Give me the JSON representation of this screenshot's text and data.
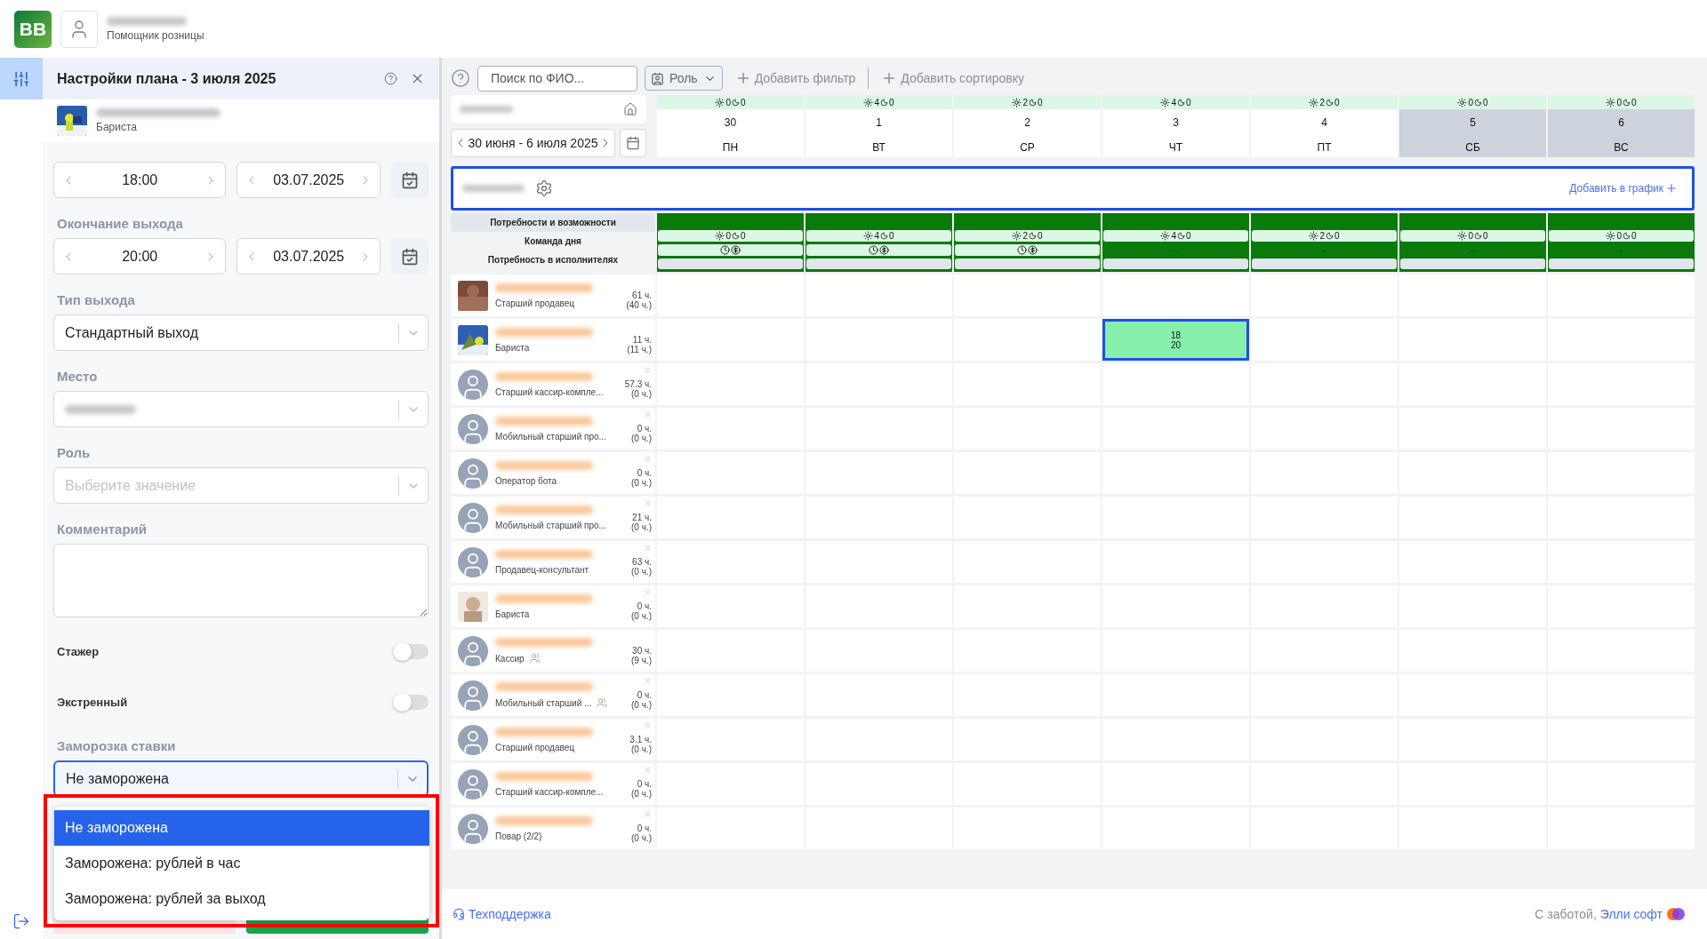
{
  "app": {
    "logo": "BB",
    "user_role": "Помощник розницы"
  },
  "panel": {
    "title": "Настройки плана - 3 июля 2025",
    "employee_role": "Бариста",
    "start": {
      "time": "18:00",
      "date": "03.07.2025"
    },
    "end": {
      "label": "Окончание выхода",
      "time": "20:00",
      "date": "03.07.2025"
    },
    "shift_type": {
      "label": "Тип выхода",
      "value": "Стандартный выход"
    },
    "place": {
      "label": "Место"
    },
    "role": {
      "label": "Роль",
      "placeholder": "Выберите значение"
    },
    "comment": {
      "label": "Комментарий"
    },
    "toggles": [
      {
        "label": "Стажер",
        "on": false
      },
      {
        "label": "Экстренный",
        "on": false
      }
    ],
    "freeze": {
      "label": "Заморозка ставки",
      "value": "Не заморожена",
      "open": true,
      "options": [
        {
          "label": "Не заморожена",
          "selected": true
        },
        {
          "label": "Заморожена: рублей в час",
          "selected": false
        },
        {
          "label": "Заморожена: рублей за выход",
          "selected": false
        }
      ]
    }
  },
  "toolbar": {
    "search_placeholder": "Поиск по ФИО...",
    "role_filter": "Роль",
    "add_filter": "Добавить фильтр",
    "add_sort": "Добавить сортировку"
  },
  "week": "30 июня - 6 июля 2025",
  "days": [
    {
      "num": "30",
      "weekday": "ПН",
      "sun": "0",
      "moon": "0",
      "weekend": false,
      "need_sun": "0",
      "need_moon": "0",
      "team": {
        "kind": "icons"
      }
    },
    {
      "num": "1",
      "weekday": "ВТ",
      "sun": "4",
      "moon": "0",
      "weekend": false,
      "need_sun": "4",
      "need_moon": "0",
      "team": {
        "kind": "icons"
      }
    },
    {
      "num": "2",
      "weekday": "СР",
      "sun": "2",
      "moon": "0",
      "weekend": false,
      "need_sun": "2",
      "need_moon": "0",
      "team": {
        "kind": "icons"
      }
    },
    {
      "num": "3",
      "weekday": "ЧТ",
      "sun": "4",
      "moon": "0",
      "weekend": false,
      "need_sun": "4",
      "need_moon": "0",
      "team": {
        "kind": "dash",
        "text": "-"
      }
    },
    {
      "num": "4",
      "weekday": "ПТ",
      "sun": "2",
      "moon": "0",
      "weekend": false,
      "need_sun": "2",
      "need_moon": "0",
      "team": {
        "kind": "dash",
        "text": "-"
      }
    },
    {
      "num": "5",
      "weekday": "СБ",
      "sun": "0",
      "moon": "0",
      "weekend": true,
      "need_sun": "0",
      "need_moon": "0",
      "team": {
        "kind": "dash",
        "text": "-"
      }
    },
    {
      "num": "6",
      "weekday": "ВС",
      "sun": "0",
      "moon": "0",
      "weekend": true,
      "need_sun": "0",
      "need_moon": "0",
      "team": {
        "kind": "dash",
        "text": "-"
      }
    }
  ],
  "group": {
    "add_label": "Добавить в график"
  },
  "need_labels": [
    "Потребности и возможности",
    "Команда дня",
    "Потребность в исполнителях"
  ],
  "employees": [
    {
      "role": "Старший продавец",
      "hours": "61 ч.",
      "planned": "(40 ч.)",
      "removable": false,
      "group_icon": false
    },
    {
      "role": "Бариста",
      "hours": "11 ч.",
      "planned": "(11 ч.)",
      "removable": false,
      "group_icon": false,
      "cells": [
        {
          "shift": false
        },
        {
          "shift": false
        },
        {
          "shift": false
        },
        {
          "shift": true,
          "start": "18",
          "end": "20",
          "selected": true
        },
        {
          "shift": false
        },
        {
          "shift": false
        },
        {
          "shift": false
        }
      ]
    },
    {
      "kind": "default",
      "role": "Старший кассир-компле...",
      "hours": "57.3 ч.",
      "planned": "(0 ч.)",
      "removable": true,
      "group_icon": false
    },
    {
      "kind": "default",
      "role": "Мобильный старший про...",
      "hours": "0 ч.",
      "planned": "(0 ч.)",
      "removable": true,
      "group_icon": false
    },
    {
      "kind": "default",
      "role": "Оператор бота",
      "hours": "0 ч.",
      "planned": "(0 ч.)",
      "removable": true,
      "group_icon": false
    },
    {
      "kind": "default",
      "role": "Мобильный старший про...",
      "hours": "21 ч.",
      "planned": "(0 ч.)",
      "removable": true,
      "group_icon": false
    },
    {
      "kind": "default",
      "role": "Продавец-консультант",
      "hours": "63 ч.",
      "planned": "(0 ч.)",
      "removable": true,
      "group_icon": false
    },
    {
      "role": "Бариста",
      "hours": "0 ч.",
      "planned": "(0 ч.)",
      "removable": true,
      "group_icon": false
    },
    {
      "kind": "default",
      "role": "Кассир",
      "hours": "30 ч.",
      "planned": "(9 ч.)",
      "removable": false,
      "group_icon": true
    },
    {
      "kind": "default",
      "role": "Мобильный старший ...",
      "hours": "0 ч.",
      "planned": "(0 ч.)",
      "removable": true,
      "group_icon": true
    },
    {
      "kind": "default",
      "role": "Старший продавец",
      "hours": "3.1 ч.",
      "planned": "(0 ч.)",
      "removable": true,
      "group_icon": false
    },
    {
      "kind": "default",
      "role": "Старший кассир-компле...",
      "hours": "0 ч.",
      "planned": "(0 ч.)",
      "removable": true,
      "group_icon": false
    },
    {
      "kind": "default",
      "role": "Повар (2/2)",
      "hours": "0 ч.",
      "planned": "(0 ч.)",
      "removable": true,
      "group_icon": false
    }
  ],
  "footer": {
    "support": "Техподдержка",
    "care": "С заботой,",
    "brand": "Элли софт"
  }
}
